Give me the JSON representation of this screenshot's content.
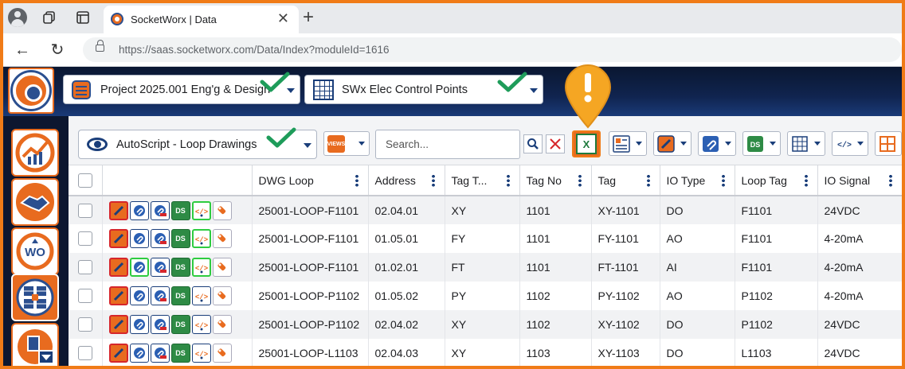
{
  "browser": {
    "tab_title": "SocketWorx | Data",
    "url": "https://saas.socketworx.com/Data/Index?moduleId=1616",
    "new_tab": "+"
  },
  "header": {
    "project_select": "Project 2025.001 Eng'g & Design",
    "module_select": "SWx Elec Control Points"
  },
  "sidebar": {
    "items": [
      {
        "name": "dashboard",
        "glyph": "📈"
      },
      {
        "name": "partners",
        "glyph": "🤝"
      },
      {
        "name": "work-orders",
        "glyph": "WO"
      },
      {
        "name": "data",
        "glyph": "▦"
      },
      {
        "name": "documents",
        "glyph": "▾"
      }
    ]
  },
  "toolbar": {
    "autoscript_select": "AutoScript - Loop Drawings",
    "views_label": "VIEWS",
    "search_placeholder": "Search...",
    "excel_label": "X"
  },
  "grid": {
    "columns": [
      "DWG Loop",
      "Address",
      "Tag T...",
      "Tag No",
      "Tag",
      "IO Type",
      "Loop Tag",
      "IO Signal"
    ],
    "rows": [
      {
        "dwg_loop": "25001-LOOP-F1101",
        "address": "02.04.01",
        "tag_type": "XY",
        "tag_no": "1101",
        "tag": "XY-1101",
        "io_type": "DO",
        "loop_tag": "F1101",
        "io_signal": "24VDC",
        "hl": [
          4
        ]
      },
      {
        "dwg_loop": "25001-LOOP-F1101",
        "address": "01.05.01",
        "tag_type": "FY",
        "tag_no": "1101",
        "tag": "FY-1101",
        "io_type": "AO",
        "loop_tag": "F1101",
        "io_signal": "4-20mA",
        "hl": [
          4
        ]
      },
      {
        "dwg_loop": "25001-LOOP-F1101",
        "address": "01.02.01",
        "tag_type": "FT",
        "tag_no": "1101",
        "tag": "FT-1101",
        "io_type": "AI",
        "loop_tag": "F1101",
        "io_signal": "4-20mA",
        "hl": [
          1,
          4
        ]
      },
      {
        "dwg_loop": "25001-LOOP-P1102",
        "address": "01.05.02",
        "tag_type": "PY",
        "tag_no": "1102",
        "tag": "PY-1102",
        "io_type": "AO",
        "loop_tag": "P1102",
        "io_signal": "4-20mA",
        "hl": []
      },
      {
        "dwg_loop": "25001-LOOP-P1102",
        "address": "02.04.02",
        "tag_type": "XY",
        "tag_no": "1102",
        "tag": "XY-1102",
        "io_type": "DO",
        "loop_tag": "P1102",
        "io_signal": "24VDC",
        "hl": []
      },
      {
        "dwg_loop": "25001-LOOP-L1103",
        "address": "02.04.03",
        "tag_type": "XY",
        "tag_no": "1103",
        "tag": "XY-1103",
        "io_type": "DO",
        "loop_tag": "L1103",
        "io_signal": "24VDC",
        "hl": []
      }
    ],
    "action_icons": [
      "drawing-icon",
      "attachment-icon",
      "attachment-remove-icon",
      "ds-icon",
      "code-icon",
      "tag-icon"
    ]
  },
  "colors": {
    "brand_orange": "#e86b1f",
    "brand_navy": "#1a3e7a",
    "highlight_green": "#2ecc40",
    "checkmark_green": "#1e9c5a",
    "pin_orange": "#f5a623"
  }
}
